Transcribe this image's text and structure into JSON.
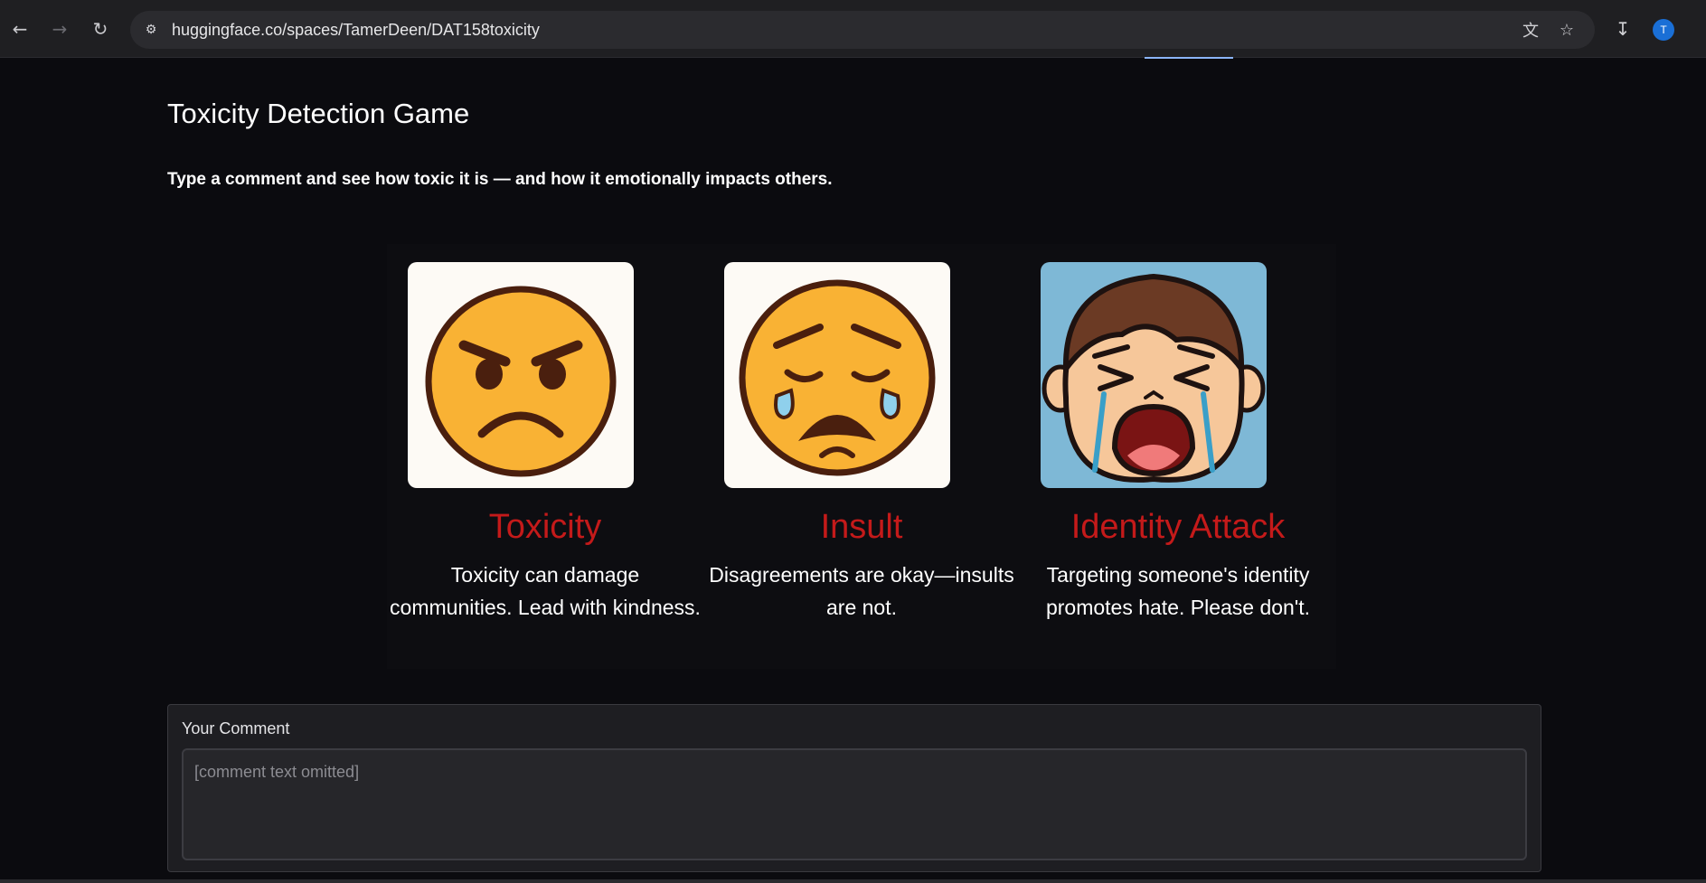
{
  "browser": {
    "url": "huggingface.co/spaces/TamerDeen/DAT158toxicity",
    "avatar_letter": "T",
    "icons": [
      "back-arrow-icon",
      "forward-arrow-icon",
      "reload-icon",
      "site-settings-icon",
      "translate-icon",
      "star-icon",
      "download-icon"
    ]
  },
  "page": {
    "title": "Toxicity Detection Game",
    "subtitle": "Type a comment and see how toxic it is — and how it emotionally impacts others."
  },
  "cards": [
    {
      "title": "Toxicity",
      "description": "Toxicity can damage communities. Lead with kindness.",
      "image": "angry-face-emoji",
      "bg": "#fdfaf5"
    },
    {
      "title": "Insult",
      "description": "Disagreements are okay—insults are not.",
      "image": "sad-crying-face-emoji",
      "bg": "#fdfaf5"
    },
    {
      "title": "Identity Attack",
      "description": "Targeting someone's identity promotes hate. Please don't.",
      "image": "crying-boy-illustration",
      "bg": "#7eb8d6"
    }
  ],
  "comment": {
    "label": "Your Comment",
    "placeholder": "[comment text omitted]"
  },
  "colors": {
    "accent_red": "#c41a1a",
    "background": "#0b0b0f"
  }
}
